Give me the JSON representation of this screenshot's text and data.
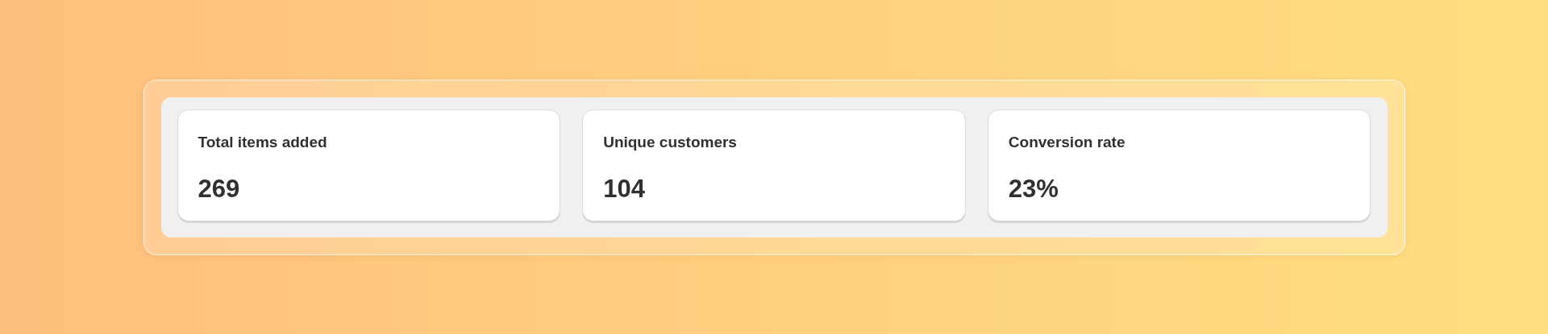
{
  "metrics": [
    {
      "label": "Total items added",
      "value": "269"
    },
    {
      "label": "Unique customers",
      "value": "104"
    },
    {
      "label": "Conversion rate",
      "value": "23%"
    }
  ]
}
